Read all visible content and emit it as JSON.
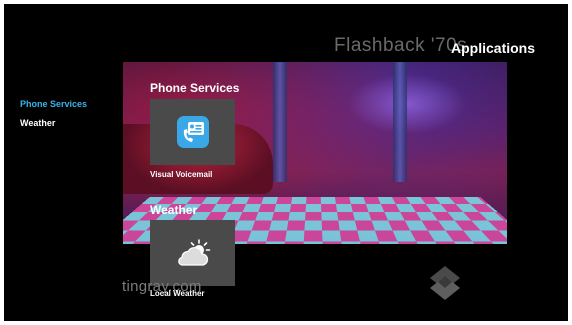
{
  "header": {
    "channel_title": "Flashback '70s",
    "page_title": "Applications"
  },
  "sidebar": {
    "items": [
      {
        "label": "Phone Services",
        "active": true
      },
      {
        "label": "Weather",
        "active": false
      }
    ]
  },
  "sections": [
    {
      "heading": "Phone Services",
      "apps": [
        {
          "label": "Visual Voicemail",
          "icon": "voicemail-contact-card-icon"
        }
      ]
    },
    {
      "heading": "Weather",
      "apps": [
        {
          "label": "Local Weather",
          "icon": "cloud-sun-icon"
        }
      ]
    }
  ],
  "watermark": "tingray.com",
  "colors": {
    "background": "#000000",
    "active_accent": "#39b4ea",
    "tile_background": "#4a4a4a",
    "voicemail_icon": "#3aa8e6"
  }
}
